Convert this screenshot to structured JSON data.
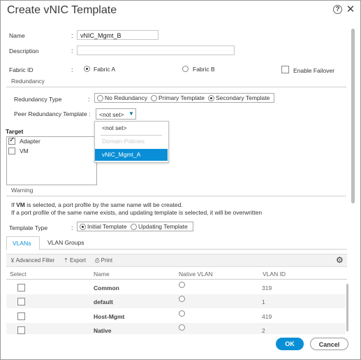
{
  "window": {
    "title": "Create vNIC Template",
    "help_glyph": "?",
    "close_glyph": "✕"
  },
  "form": {
    "name_label": "Name",
    "name_value": "vNIC_Mgmt_B",
    "description_label": "Description",
    "description_value": "",
    "fabric_label": "Fabric ID",
    "fabric_a": "Fabric A",
    "fabric_b": "Fabric B",
    "fabric_selected": "Fabric A",
    "enable_failover": "Enable Failover",
    "colon": ":"
  },
  "redundancy": {
    "section": "Redundancy",
    "type_label": "Redundancy Type",
    "options": [
      "No Redundancy",
      "Primary Template",
      "Secondary Template"
    ],
    "selected": "Secondary Template",
    "peer_label": "Peer Redundancy Template :",
    "peer_value": "<not set>",
    "peer_options": [
      "<not set>",
      "Domain Policies",
      "vNIC_Mgmt_A"
    ],
    "peer_highlighted": "vNIC_Mgmt_A"
  },
  "target": {
    "label": "Target",
    "items": [
      {
        "label": "Adapter",
        "checked": true
      },
      {
        "label": "VM",
        "checked": false
      }
    ]
  },
  "warning": {
    "section": "Warning",
    "line1_a": "If ",
    "line1_b": "VM",
    "line1_c": " is selected, a port profile by the same name will be created.",
    "line2": "If a port profile of the same name exists, and updating template is selected, it will be overwritten"
  },
  "template_type": {
    "label": "Template Type",
    "options": [
      "Initial Template",
      "Updating Template"
    ],
    "selected": "Initial Template"
  },
  "tabs": [
    "VLANs",
    "VLAN Groups"
  ],
  "toolbar": {
    "filter": "Advanced Filter",
    "export": "Export",
    "print": "Print",
    "settings_glyph": "⚙"
  },
  "table": {
    "headers": [
      "Select",
      "Name",
      "Native VLAN",
      "VLAN ID"
    ],
    "rows": [
      {
        "name": "Common",
        "vlan_id": "319"
      },
      {
        "name": "default",
        "vlan_id": "1"
      },
      {
        "name": "Host-Mgmt",
        "vlan_id": "419"
      },
      {
        "name": "Native",
        "vlan_id": "2"
      }
    ]
  },
  "buttons": {
    "ok": "OK",
    "cancel": "Cancel"
  },
  "colors": {
    "accent": "#0a8fd6",
    "selected_row": "#0a8fd6"
  }
}
